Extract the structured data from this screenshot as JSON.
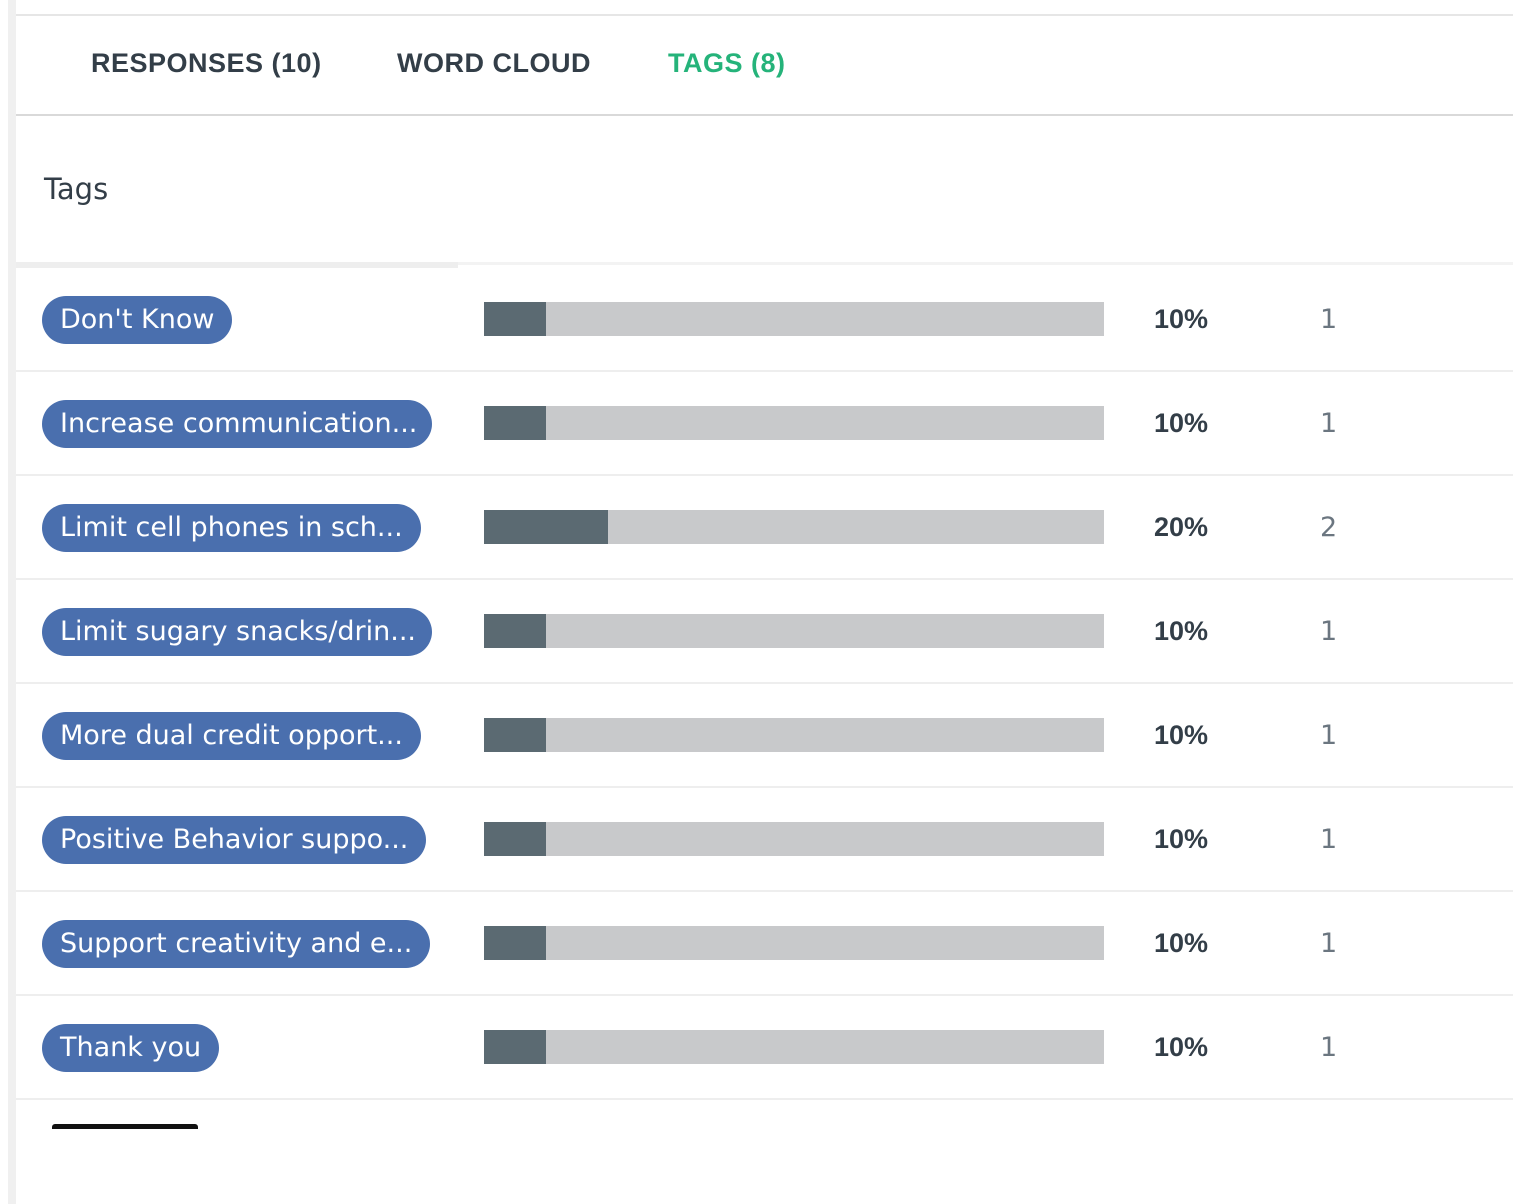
{
  "tabs": [
    {
      "label": "RESPONSES (10)",
      "active": false
    },
    {
      "label": "WORD CLOUD",
      "active": false
    },
    {
      "label": "TAGS (8)",
      "active": true
    }
  ],
  "section_title": "Tags",
  "colors": {
    "active_tab": "#25b37a",
    "tag_pill": "#4a6fae",
    "bar_fill": "#5b6a72",
    "bar_track": "#c8c9cb",
    "text_dark": "#333e48"
  },
  "tags": [
    {
      "label": "Don't Know",
      "percent": "10%",
      "share": 0.1,
      "count": "1"
    },
    {
      "label": "Increase communication...",
      "percent": "10%",
      "share": 0.1,
      "count": "1"
    },
    {
      "label": "Limit cell phones in sch...",
      "percent": "20%",
      "share": 0.2,
      "count": "2"
    },
    {
      "label": "Limit sugary snacks/drin...",
      "percent": "10%",
      "share": 0.1,
      "count": "1"
    },
    {
      "label": "More dual credit opport...",
      "percent": "10%",
      "share": 0.1,
      "count": "1"
    },
    {
      "label": "Positive Behavior suppo...",
      "percent": "10%",
      "share": 0.1,
      "count": "1"
    },
    {
      "label": "Support creativity and e...",
      "percent": "10%",
      "share": 0.1,
      "count": "1"
    },
    {
      "label": "Thank you",
      "percent": "10%",
      "share": 0.1,
      "count": "1"
    }
  ]
}
